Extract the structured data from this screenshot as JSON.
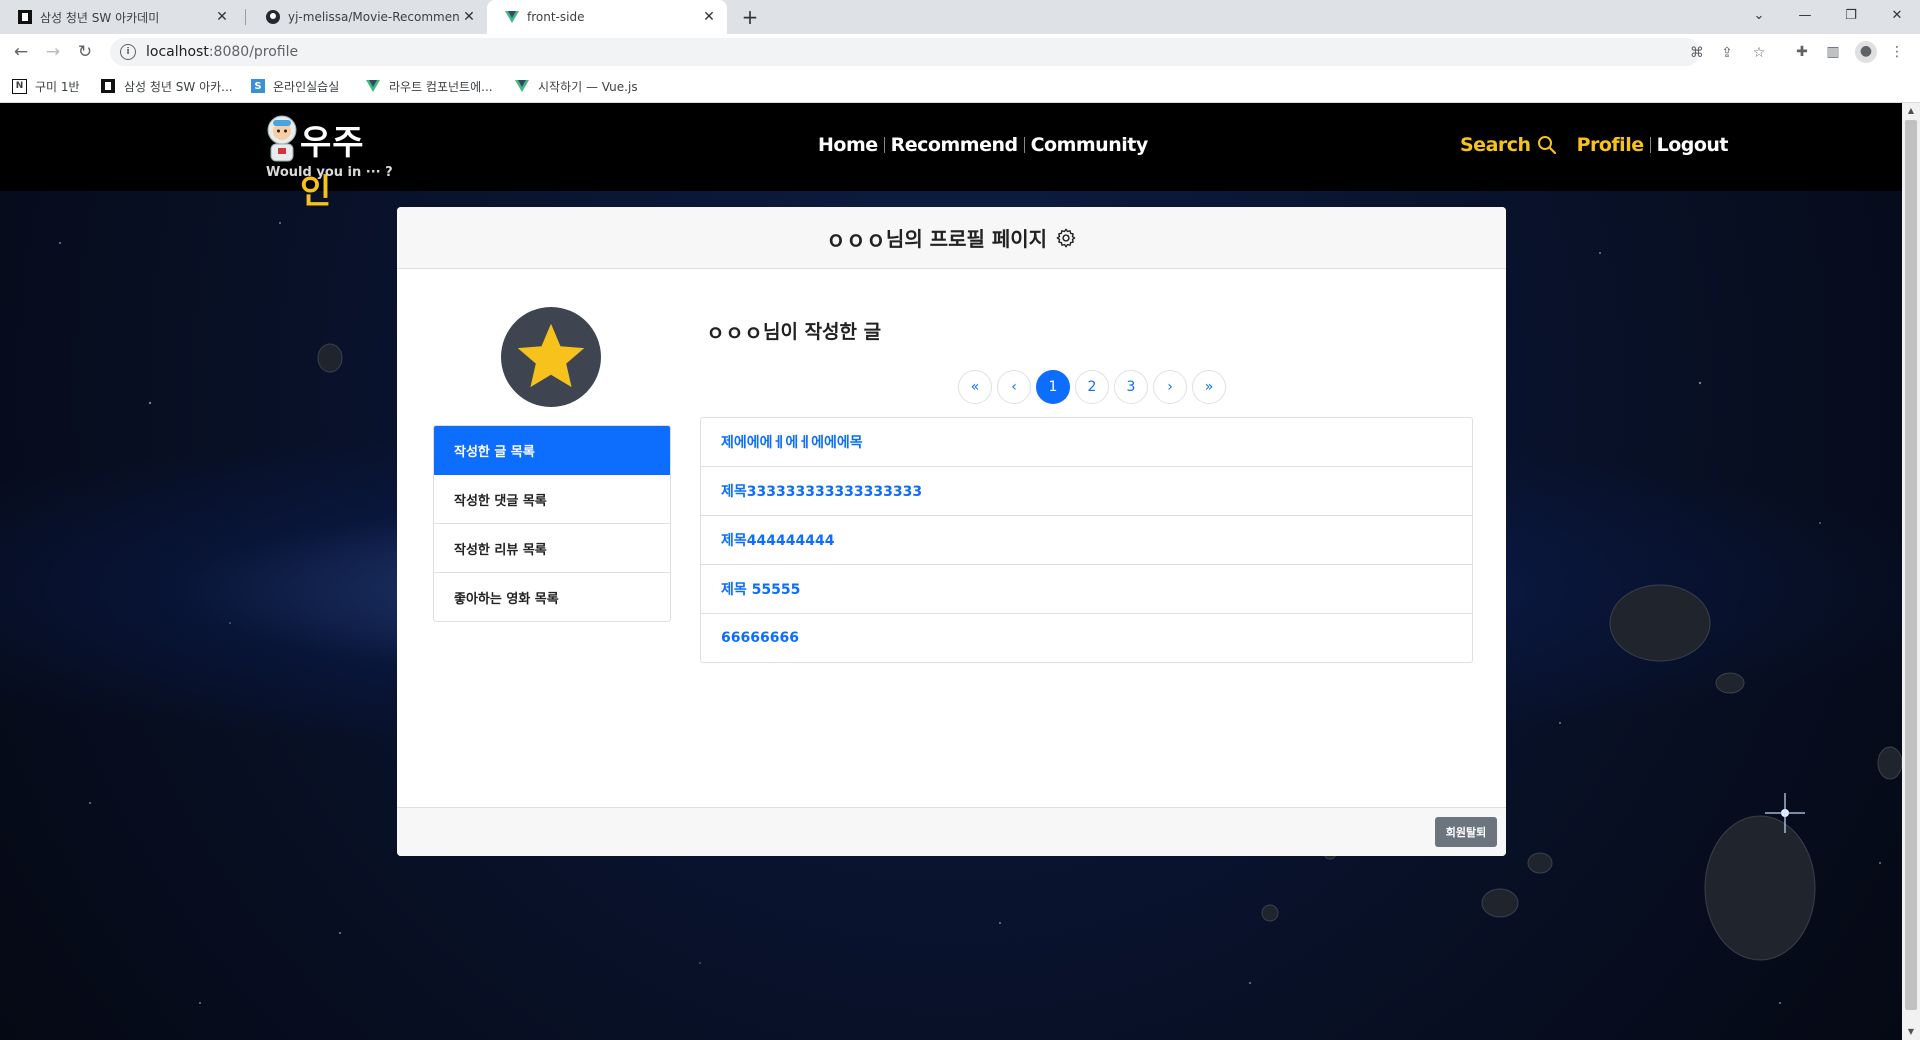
{
  "browser": {
    "tabs": [
      {
        "title": "삼성 청년 SW 아카데미",
        "icon": "ssafy-icon",
        "active": false
      },
      {
        "title": "yj-melissa/Movie-Recommend-T",
        "icon": "github-icon",
        "active": false
      },
      {
        "title": "front-side",
        "icon": "vue-icon",
        "active": true
      }
    ],
    "new_tab": "+",
    "window_controls": {
      "dropdown": "⌄",
      "minimize": "—",
      "restore": "❐",
      "close": "✕"
    },
    "nav": {
      "back": "←",
      "forward": "→",
      "reload": "↻"
    },
    "url_host": "localhost",
    "url_path": ":8080/profile",
    "bookmarks": [
      {
        "label": "구미 1반",
        "icon": "notion-icon"
      },
      {
        "label": "삼성 청년 SW 아카...",
        "icon": "ssafy-icon"
      },
      {
        "label": "온라인실습실",
        "icon": "edu-icon"
      },
      {
        "label": "라우트 컴포넌트에...",
        "icon": "vue-icon"
      },
      {
        "label": "시작하기 — Vue.js",
        "icon": "vue-icon"
      }
    ]
  },
  "site": {
    "logo_text": "우주인",
    "logo_text_a": "우주",
    "logo_text_b": "인",
    "logo_tagline": "Would you in ··· ?",
    "nav_center": [
      "Home",
      "Recommend",
      "Community"
    ],
    "nav_search": "Search",
    "nav_profile": "Profile",
    "nav_logout": "Logout",
    "colors": {
      "accent": "#f7c21a",
      "primary": "#0d6efd",
      "navbar": "#000000"
    }
  },
  "profile": {
    "title": "ｏｏｏ님의 프로필 페이지",
    "posts_title": "ｏｏｏ님이 작성한 글",
    "menu": [
      "작성한 글 목록",
      "작성한 댓글 목록",
      "작성한 리뷰 목록",
      "좋아하는 영화 목록"
    ],
    "active_menu_index": 0,
    "pagination": {
      "first": "«",
      "prev": "‹",
      "pages": [
        "1",
        "2",
        "3"
      ],
      "current": "1",
      "next": "›",
      "last": "»"
    },
    "posts": [
      "제에에에ㅔ에ㅔ에에에목",
      "제목333333333333333333",
      "제목444444444",
      "제목 55555",
      "66666666"
    ],
    "withdraw_button": "회원탈퇴"
  }
}
